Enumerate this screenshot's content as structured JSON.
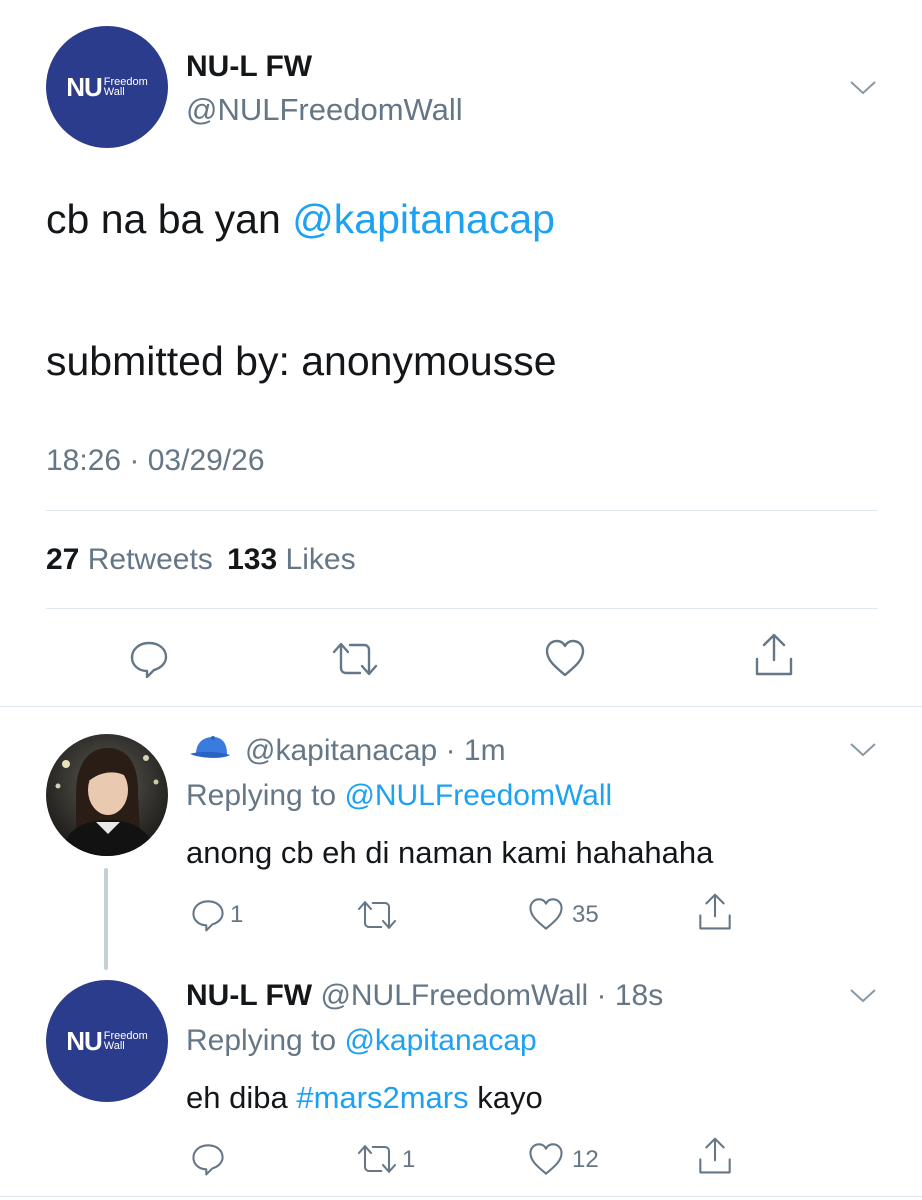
{
  "main_tweet": {
    "avatar": {
      "big": "NU",
      "small1": "Freedom",
      "small2": "Wall"
    },
    "display_name": "NU-L FW",
    "handle": "@NULFreedomWall",
    "text_before_mention": "cb na ba yan ",
    "mention": "@kapitanacap",
    "text_line2": "submitted by: anonymousse",
    "timestamp": "18:26 · 03/29/26",
    "retweets_count": "27",
    "retweets_label": "Retweets",
    "likes_count": "133",
    "likes_label": "Likes",
    "actions": [
      "reply-icon",
      "retweet-icon",
      "heart-icon",
      "share-icon"
    ]
  },
  "replies": [
    {
      "emoji_name": "blue-cap-icon",
      "handle": "@kapitanacap",
      "time": "1m",
      "replying_to_label": "Replying to",
      "replying_to": "@NULFreedomWall",
      "text": "anong cb eh di naman kami hahahaha",
      "reply_count": "1",
      "retweet_count": "",
      "like_count": "35"
    },
    {
      "display_name": "NU-L FW",
      "handle": "@NULFreedomWall",
      "time": "18s",
      "replying_to_label": "Replying to",
      "replying_to": "@kapitanacap",
      "text_before": "eh diba ",
      "hashtag": "#mars2mars",
      "text_after": " kayo",
      "reply_count": "",
      "retweet_count": "1",
      "like_count": "12"
    }
  ],
  "colors": {
    "link": "#1da1f2",
    "muted": "#657786",
    "avatar_bg": "#2c3c8c",
    "divider": "#e1e8ed"
  }
}
